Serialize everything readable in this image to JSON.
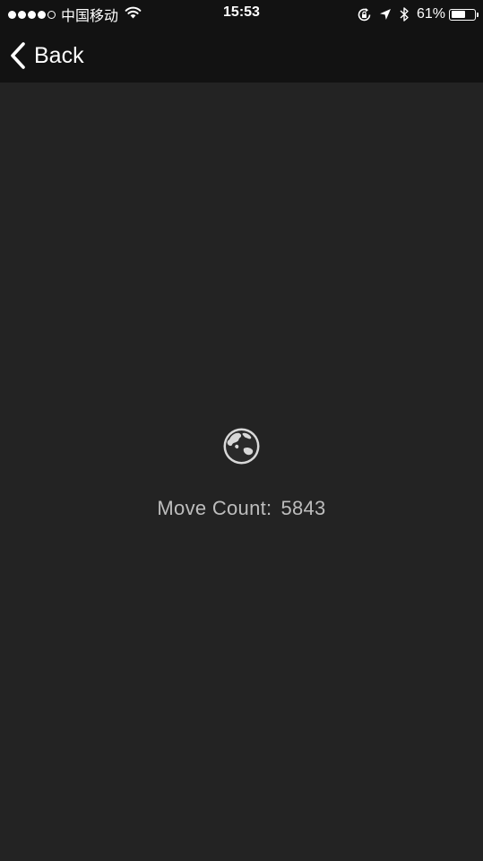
{
  "status_bar": {
    "carrier": "中国移动",
    "time": "15:53",
    "battery_percent": "61%",
    "battery_level": 0.61,
    "signal_bars": 4,
    "signal_total": 5
  },
  "nav": {
    "back_label": "Back"
  },
  "main": {
    "move_count_label": "Move Count:",
    "move_count_value": "5843"
  },
  "icons": {
    "back": "chevron-left-icon",
    "center": "globe-icon",
    "wifi": "wifi-icon",
    "orientation_lock": "orientation-lock-icon",
    "location": "location-arrow-icon",
    "bluetooth": "bluetooth-icon",
    "battery": "battery-icon"
  },
  "colors": {
    "background": "#232323",
    "bar_background": "#121212",
    "text_primary": "#ffffff",
    "text_secondary": "#bdbdbd"
  }
}
